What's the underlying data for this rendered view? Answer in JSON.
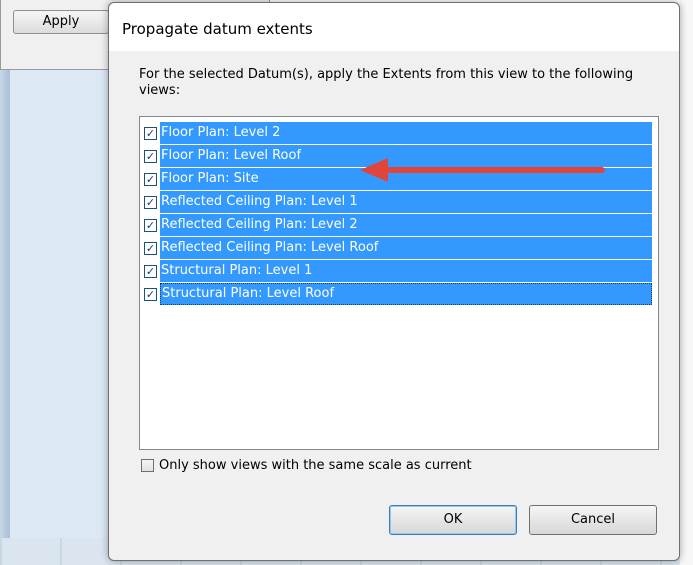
{
  "parent_dialog": {
    "apply_label": "Apply"
  },
  "dialog": {
    "title": "Propagate datum extents",
    "instructions": "For the selected Datum(s), apply the Extents from this view to the following views:",
    "views": [
      {
        "label": "Floor Plan: Level 2",
        "checked": true
      },
      {
        "label": "Floor Plan: Level Roof",
        "checked": true
      },
      {
        "label": "Floor Plan: Site",
        "checked": true
      },
      {
        "label": "Reflected Ceiling Plan: Level 1",
        "checked": true
      },
      {
        "label": "Reflected Ceiling Plan: Level 2",
        "checked": true
      },
      {
        "label": "Reflected Ceiling Plan: Level Roof",
        "checked": true
      },
      {
        "label": "Structural Plan: Level 1",
        "checked": true
      },
      {
        "label": "Structural Plan: Level Roof",
        "checked": true
      }
    ],
    "same_scale_label": "Only show views with the same scale as current",
    "same_scale_checked": false,
    "ok_label": "OK",
    "cancel_label": "Cancel"
  },
  "colors": {
    "selection": "#3399ff",
    "annotation_arrow": "#e0443a"
  },
  "icons": {
    "checkmark": "check-icon",
    "annotation": "red-arrow-icon"
  }
}
